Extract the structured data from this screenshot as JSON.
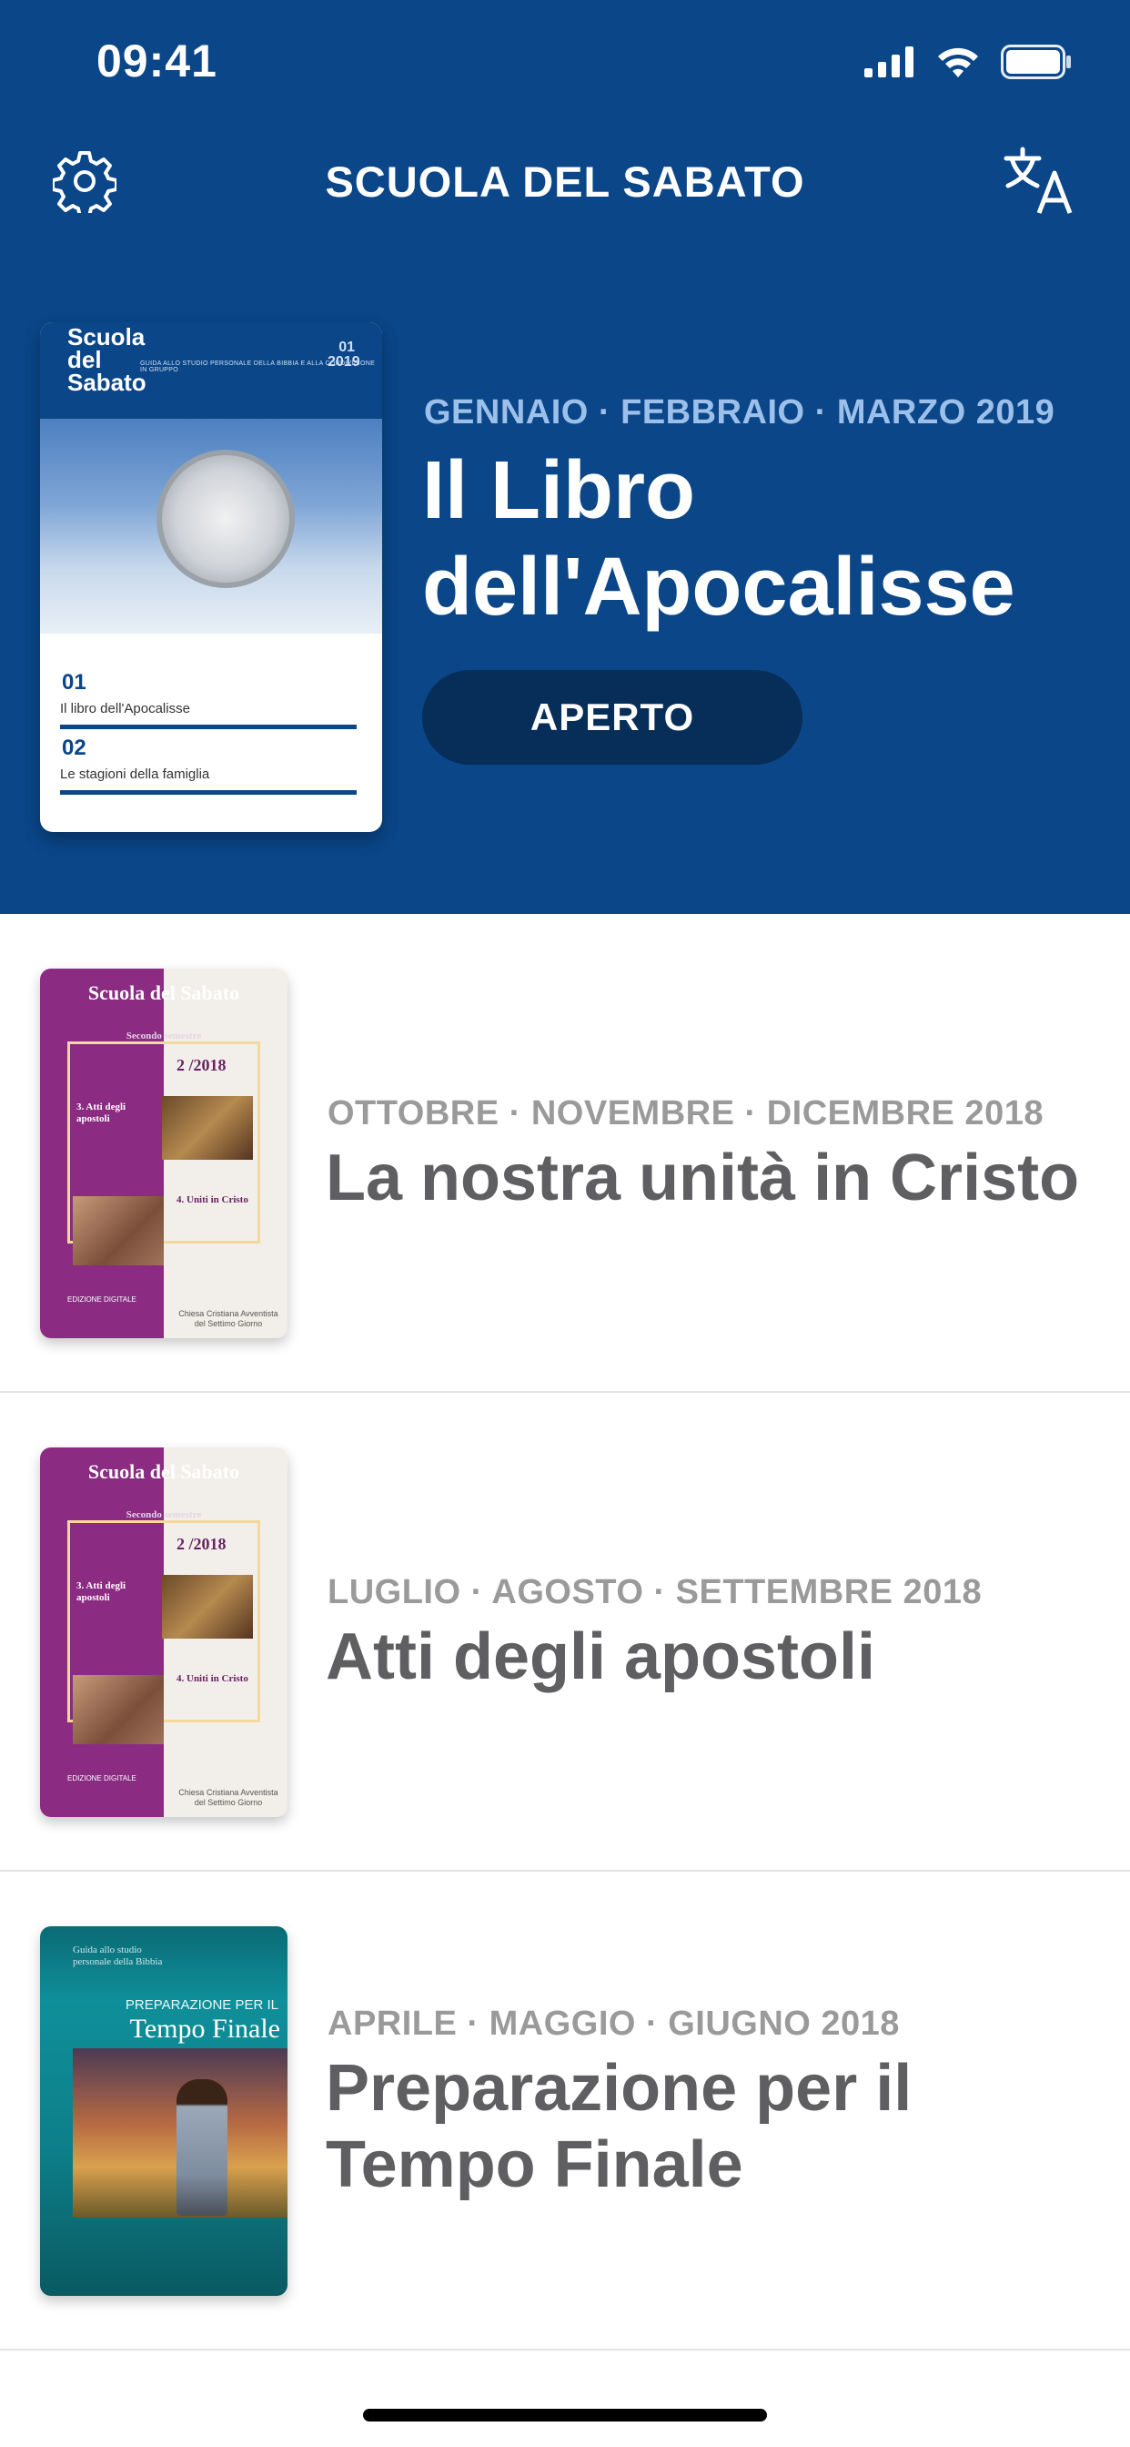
{
  "status_bar": {
    "time": "09:41"
  },
  "nav": {
    "title": "SCUOLA DEL SABATO",
    "settings_icon": "gear-icon",
    "translate_icon": "translate-icon"
  },
  "featured": {
    "kicker": "GENNAIO · FEBBRAIO · MARZO 2019",
    "title": "Il Libro dell'Apocalisse",
    "button_label": "APERTO",
    "cover": {
      "brand": "Scuola del Sabato",
      "subtitle": "GUIDA ALLO STUDIO PERSONALE DELLA BIBBIA E ALLA CONDIVISIONE IN GRUPPO",
      "year": "01 2019",
      "item1_num": "01",
      "item1_label": "Il libro dell'Apocalisse",
      "item2_num": "02",
      "item2_label": "Le stagioni della famiglia"
    },
    "colors": {
      "background": "#0a4688",
      "button": "#072d59"
    }
  },
  "lessons": [
    {
      "kicker": "OTTOBRE · NOVEMBRE · DICEMBRE 2018",
      "title": "La nostra unità in Cristo",
      "cover": {
        "header": "Scuola del Sabato",
        "subheader": "Secondo semestre",
        "number": "2 /2018",
        "text1": "3. Atti degli apostoli",
        "text2": "4. Uniti in Cristo",
        "foot1": "EDIZIONE DIGITALE",
        "foot2": "Chiesa Cristiana Avventista del Settimo Giorno"
      }
    },
    {
      "kicker": "LUGLIO · AGOSTO · SETTEMBRE 2018",
      "title": "Atti degli apostoli",
      "cover": {
        "header": "Scuola del Sabato",
        "subheader": "Secondo semestre",
        "number": "2 /2018",
        "text1": "3. Atti degli apostoli",
        "text2": "4. Uniti in Cristo",
        "foot1": "EDIZIONE DIGITALE",
        "foot2": "Chiesa Cristiana Avventista del Settimo Giorno"
      }
    },
    {
      "kicker": "APRILE · MAGGIO · GIUGNO 2018",
      "title": "Preparazione per il Tempo Finale",
      "cover": {
        "guide": "Guida allo studio personale della Bibbia",
        "line1": "PREPARAZIONE PER IL",
        "line2": "Tempo Finale"
      }
    }
  ]
}
